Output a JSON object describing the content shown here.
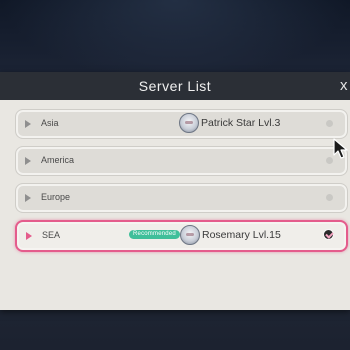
{
  "dialog": {
    "title": "Server List",
    "close_label": "x"
  },
  "servers": [
    {
      "region": "Asia",
      "player": "Patrick Star  Lvl.3",
      "selected": false
    },
    {
      "region": "America",
      "player": "",
      "selected": false
    },
    {
      "region": "Europe",
      "player": "",
      "selected": false
    },
    {
      "region": "SEA",
      "badge": "Recommended",
      "player": "Rosemary  Lvl.15",
      "selected": true
    }
  ],
  "colors": {
    "accent": "#e45c8c",
    "badge": "#3fbf9a",
    "panel": "#e9e7e2",
    "header": "#2b2f36"
  },
  "icons": {
    "row_indicator": "play-triangle-icon",
    "avatar": "character-avatar-icon",
    "selected": "check-circle-icon",
    "idle": "status-dot-icon",
    "pointer": "mouse-cursor-icon"
  }
}
